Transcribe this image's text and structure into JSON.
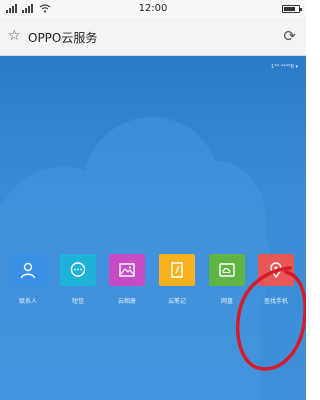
{
  "status_bar": {
    "time": "12:00",
    "battery_level": 0.8
  },
  "address_bar": {
    "title": "OPPO云服务"
  },
  "account": {
    "masked_number": "1**·****8 ▾"
  },
  "apps": [
    {
      "label": "联系人",
      "color": "#3a90e6",
      "icon": "person-icon"
    },
    {
      "label": "短信",
      "color": "#1fb2d8",
      "icon": "chat-bubble-icon"
    },
    {
      "label": "云相册",
      "color": "#c64cc6",
      "icon": "picture-icon"
    },
    {
      "label": "云笔记",
      "color": "#f5b120",
      "icon": "note-icon"
    },
    {
      "label": "网盘",
      "color": "#5fb444",
      "icon": "cloud-drive-icon"
    },
    {
      "label": "查找手机",
      "color": "#e85656",
      "icon": "location-pin-icon"
    }
  ]
}
